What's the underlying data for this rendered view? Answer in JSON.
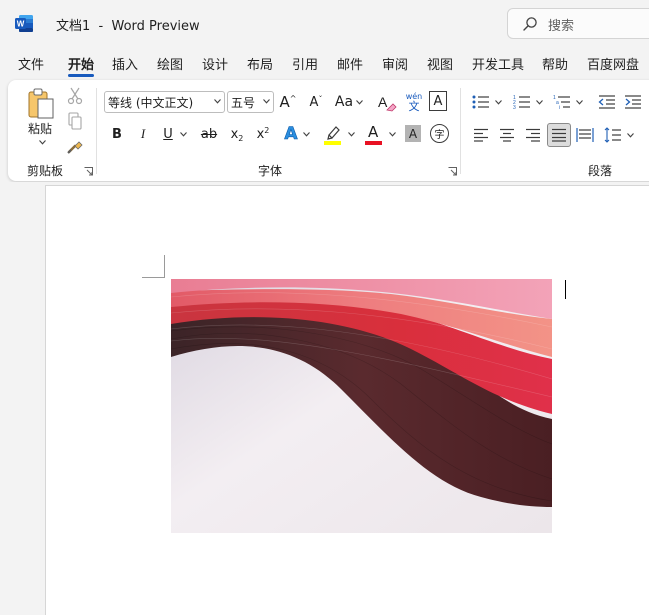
{
  "app": {
    "doc_name": "文档1",
    "separator": "-",
    "app_name": "Word Preview",
    "search_placeholder": "搜索"
  },
  "tabs": [
    {
      "label": "文件"
    },
    {
      "label": "开始",
      "active": true
    },
    {
      "label": "插入"
    },
    {
      "label": "绘图"
    },
    {
      "label": "设计"
    },
    {
      "label": "布局"
    },
    {
      "label": "引用"
    },
    {
      "label": "邮件"
    },
    {
      "label": "审阅"
    },
    {
      "label": "视图"
    },
    {
      "label": "开发工具"
    },
    {
      "label": "帮助"
    },
    {
      "label": "百度网盘"
    }
  ],
  "ribbon": {
    "clipboard": {
      "label": "剪贴板",
      "paste_label": "粘贴"
    },
    "font": {
      "label": "字体",
      "font_name": "等线 (中文正文)",
      "font_size": "五号",
      "bold": "B",
      "italic": "I",
      "underline": "U",
      "strike": "ab",
      "subscript": "x",
      "superscript": "x",
      "change_case": "Aa",
      "phonetic_top": "wén",
      "phonetic_bottom": "文",
      "char_border": "A",
      "grow": "A",
      "shrink": "A",
      "text_effect": "A",
      "font_color": "A",
      "char_shading": "A",
      "enclose": "字"
    },
    "paragraph": {
      "label": "段落"
    }
  },
  "colors": {
    "accent": "#185abd",
    "highlight": "#ffff00",
    "font_color": "#e81123",
    "word_blue": "#185abd"
  }
}
